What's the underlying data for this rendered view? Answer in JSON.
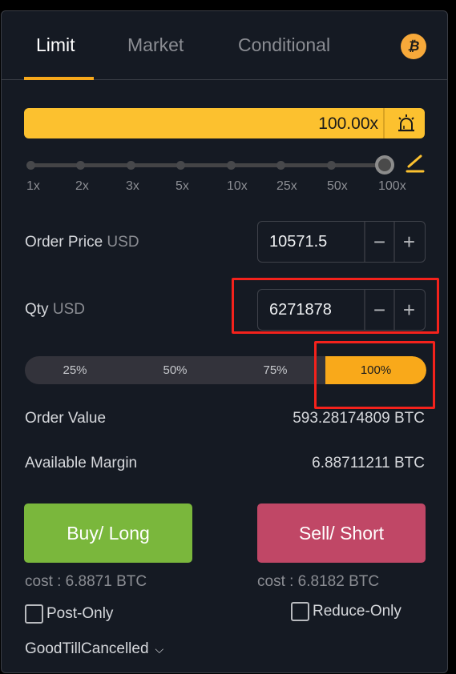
{
  "tabs": [
    {
      "label": "Limit",
      "active": true
    },
    {
      "label": "Market",
      "active": false
    },
    {
      "label": "Conditional",
      "active": false
    }
  ],
  "coin_icon": {
    "name": "bitcoin-icon",
    "glyph": "₿"
  },
  "leverage": {
    "value": "100.00x",
    "alarm_icon": "alarm-icon",
    "slider_marks": [
      "1x",
      "2x",
      "3x",
      "5x",
      "10x",
      "25x",
      "50x",
      "100x"
    ],
    "selected_mark": "100x",
    "edit_icon": "pencil-icon"
  },
  "order_price": {
    "label": "Order Price",
    "unit": "USD",
    "value": "10571.5",
    "minus": "−",
    "plus": "+"
  },
  "qty": {
    "label": "Qty",
    "unit": "USD",
    "value": "6271878",
    "minus": "−",
    "plus": "+"
  },
  "percent_options": [
    {
      "label": "25%",
      "active": false
    },
    {
      "label": "50%",
      "active": false
    },
    {
      "label": "75%",
      "active": false
    },
    {
      "label": "100%",
      "active": true
    }
  ],
  "order_value": {
    "label": "Order Value",
    "value": "593.28174809 BTC"
  },
  "available_margin": {
    "label": "Available Margin",
    "value": "6.88711211 BTC"
  },
  "buy": {
    "label": "Buy/ Long",
    "cost": "cost : 6.8871 BTC"
  },
  "sell": {
    "label": "Sell/ Short",
    "cost": "cost : 6.8182 BTC"
  },
  "post_only": {
    "label": "Post-Only",
    "checked": false
  },
  "reduce_only": {
    "label": "Reduce-Only",
    "checked": false
  },
  "time_in_force": {
    "value": "GoodTillCancelled",
    "chevron": "⌄"
  },
  "colors": {
    "accent": "#f7a81b",
    "leverage_bar": "#fcc12f",
    "buy": "#7ab73c",
    "sell": "#c04766",
    "panel_bg": "#151a23",
    "highlight": "#f4221c"
  }
}
